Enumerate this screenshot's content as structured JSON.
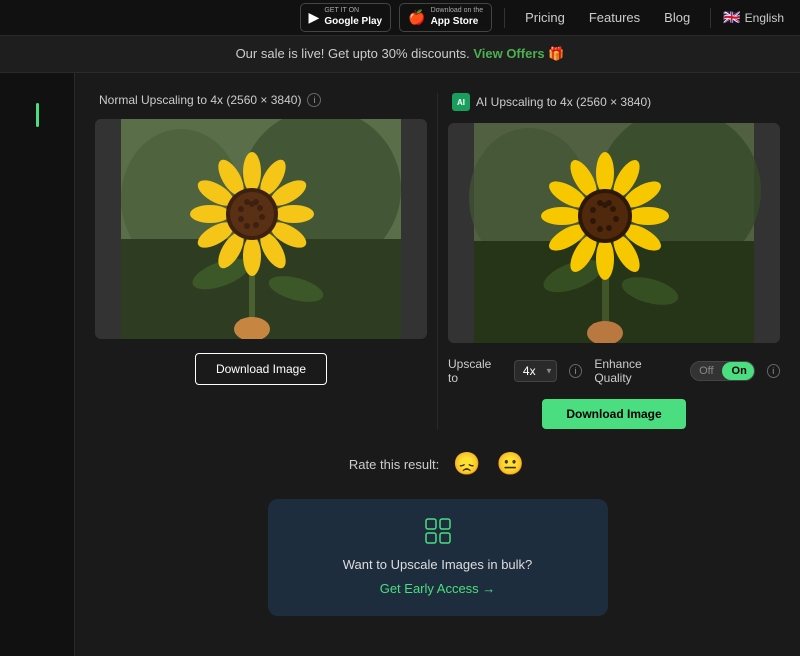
{
  "nav": {
    "google_play": {
      "top_line": "GET IT ON",
      "main_line": "Google Play"
    },
    "app_store": {
      "top_line": "Download on the",
      "main_line": "App Store"
    },
    "links": [
      "Pricing",
      "Features",
      "Blog"
    ],
    "lang": "English"
  },
  "banner": {
    "text": "Our sale is live! Get upto 30% discounts.",
    "link_text": "View Offers",
    "emoji": "🎁"
  },
  "panels": {
    "left": {
      "title": "Normal Upscaling to 4x (2560 × 3840)",
      "download_label": "Download Image"
    },
    "right": {
      "title": "AI Upscaling to 4x (2560 × 3840)",
      "download_label": "Download Image",
      "upscale_label": "Upscale to",
      "upscale_value": "4x",
      "enhance_label": "Enhance Quality",
      "toggle_off": "Off",
      "toggle_on": "On"
    }
  },
  "rating": {
    "label": "Rate this result:",
    "emoji_sad": "😞",
    "emoji_neutral": "😐"
  },
  "bulk_card": {
    "icon": "⊞",
    "title": "Want to Upscale Images in bulk?",
    "link_text": "Get Early Access →"
  }
}
